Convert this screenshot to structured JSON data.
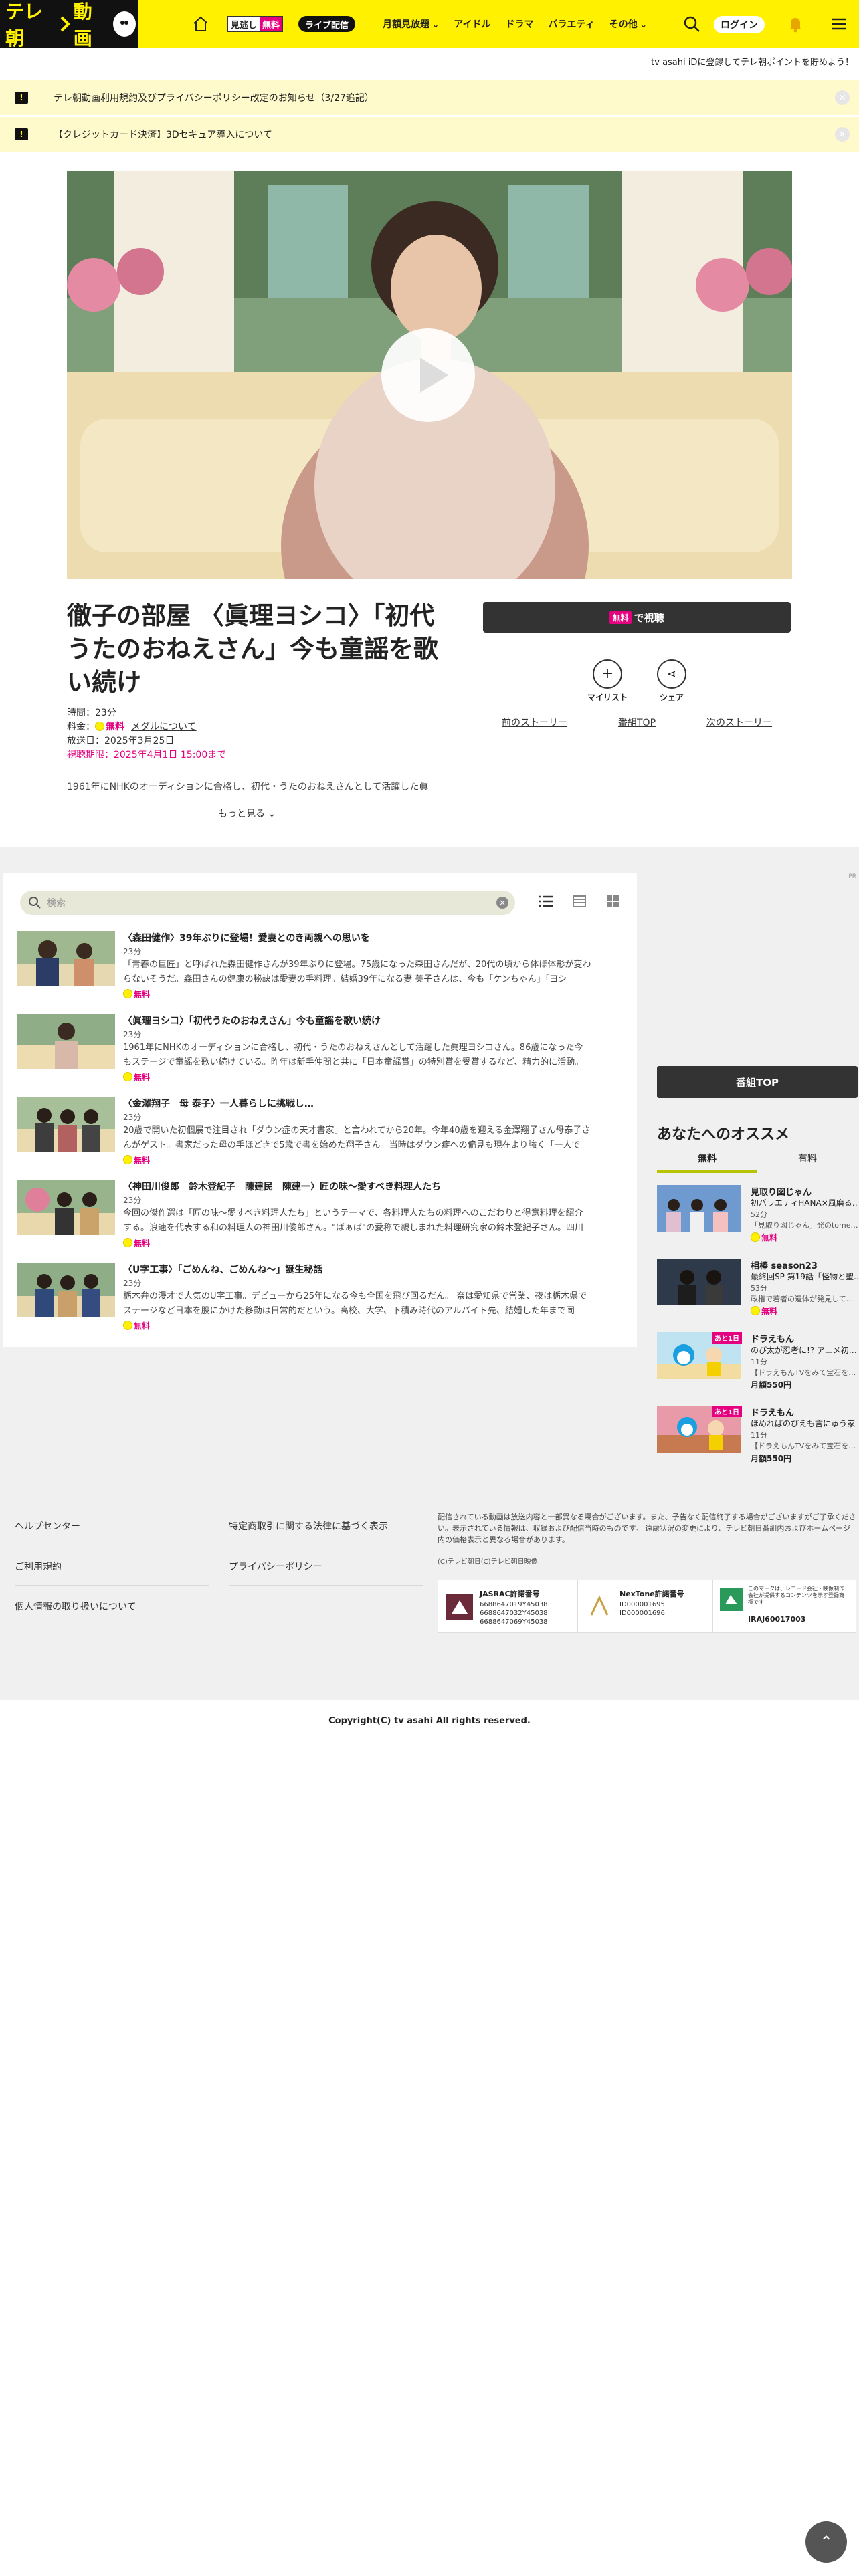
{
  "header": {
    "logo_text": "テレ朝",
    "logo_text2": "動画",
    "free_chip": [
      "見逃し",
      "無料"
    ],
    "live_chip": "ライブ配信",
    "nav": [
      "月額見放題",
      "アイドル",
      "ドラマ",
      "バラエティ",
      "その他"
    ],
    "login": "ログイン"
  },
  "promo": "tv asahi iDに登録してテレ朝ポイントを貯めよう！",
  "notices": [
    "テレ朝動画利用規約及びプライバシーポリシー改定のお知らせ（3/27追記）",
    "【クレジットカード決済】3Dセキュア導入について"
  ],
  "episode": {
    "title": "徹子の部屋 〈眞理ヨシコ〉「初代うたのおねえさん」今も童謡を歌い続け",
    "duration": "時間：23分",
    "fee_label": "料金：",
    "fee": "無料",
    "medal_link": "メダルについて",
    "aired": "放送日：2025年3月25日",
    "deadline": "視聴期限：2025年4月1日 15:00まで",
    "desc": "1961年にNHKのオーディションに合格し、初代・うたのおねえさんとして活躍した眞理ヨ",
    "more": "もっと見る",
    "watch_free": "無料",
    "watch_label": "で視聴",
    "mylist": "マイリスト",
    "share": "シェア",
    "prev": "前のストーリー",
    "program_top": "番組TOP",
    "next": "次のストーリー"
  },
  "pr": "PR",
  "search_placeholder": "検索",
  "episodes": [
    {
      "title": "〈森田健作〉39年ぶりに登場！愛妻とのき両親への思いを",
      "dur": "23分",
      "summary": "「青春の巨匠」と呼ばれた森田健作さんが39年ぶりに登場。75歳になった森田さんだが、20代の頃から体ほ体形が変わらないそうだ。森田さんの健康の秘訣は愛妻の手料理。結婚39年になる妻 美子さんは、今も「ケンちゃん」「ヨシ",
      "free": "無料"
    },
    {
      "title": "〈眞理ヨシコ〉「初代うたのおねえさん」今も童謡を歌い続け",
      "dur": "23分",
      "summary": "1961年にNHKのオーディションに合格し、初代・うたのおねえさんとして活躍した眞理ヨシコさん。86歳になった今もステージで童謡を歌い続けている。昨年は新手仲間と共に「日本童謡賞」の特別賞を受賞するなど、精力的に活動。",
      "free": "無料"
    },
    {
      "title": "〈金澤翔子　母 泰子〉一人暮らしに挑戦し…",
      "dur": "23分",
      "summary": "20歳で開いた初個展で注目され「ダウン症の天才書家」と言われてから20年。今年40歳を迎える金澤翔子さん母泰子さんがゲスト。書家だった母の手ほどきで5歳で書を始めた翔子さん。当時はダウン症への偏見も現在より強く「一人で",
      "free": "無料"
    },
    {
      "title": "〈神田川俊郎　鈴木登紀子　陳建民　陳建一〉匠の味～愛すべき料理人たち",
      "dur": "23分",
      "summary": "今回の傑作選は「匠の味～愛すべき料理人たち」というテーマで、各料理人たちの料理へのこだわりと得意料理を紹介する。浪速を代表する和の料理人の神田川俊郎さん。\"ばぁば\"の愛称で親しまれた料理研究家の鈴木登紀子さん。四川",
      "free": "無料"
    },
    {
      "title": "〈U字工事〉「ごめんね、ごめんね～」誕生秘話",
      "dur": "23分",
      "summary": "栃木弁の漫才で人気のU字工事。デビューから25年になる今も全国を飛び回るだん。 奈は愛知県で営業、夜は栃木県でステージなど日本を股にかけた移動は日常的だという。高校、大学、下積み時代のアルバイト先、結婚した年まで同",
      "free": "無料"
    }
  ],
  "sidebar": {
    "program_top": "番組TOP",
    "rec_title": "あなたへのオススメ",
    "tab_free": "無料",
    "tab_paid": "有料",
    "items": [
      {
        "t1": "見取り図じゃん",
        "t2": "初バラエティHANA×風磨る…",
        "t3": "52分",
        "t4": "「見取り図じゃん」発のtome…",
        "t5": "無料",
        "tag": ""
      },
      {
        "t1": "相棒 season23",
        "t2": "最終回SP 第19話「怪物と聖…",
        "t3": "53分",
        "t4": "政権で若者の遺体が発見して…",
        "t5": "無料",
        "tag": ""
      },
      {
        "t1": "ドラえもん",
        "t2": "のび太が忍者に!? アニメ初…",
        "t3": "11分",
        "t4": "【ドラえもんTVをみて宝石を…",
        "t5": "月額550円",
        "tag": "あと1日"
      },
      {
        "t1": "ドラえもん",
        "t2": "ほめればのびえも言にゅう家",
        "t3": "11分",
        "t4": "【ドラえもんTVをみて宝石を…",
        "t5": "月額550円",
        "tag": "あと1日"
      }
    ]
  },
  "footer": {
    "col1": [
      "ヘルプセンター",
      "ご利用規約",
      "個人情報の取り扱いについて"
    ],
    "col2": [
      "特定商取引に関する法律に基づく表示",
      "プライバシーポリシー"
    ],
    "note": "配信されている動画は放送内容と一部異なる場合がございます。また、予告なく配信終了する場合がございますがご了承ください。表示されている情報は、収録および配信当時のものです。 遠慮状況の変更により、テレビ朝日番組内およびホームページ内の価格表示と異なる場合があります。",
    "small": "(C)テレビ朝日(C)テレビ朝日映像",
    "jasrac_title": "JASRAC許諾番号",
    "jasrac_nums": "6688647019Y45038\n6688647032Y45038\n6688647069Y45038",
    "nextone_title": "NexTone許諾番号",
    "nextone_nums": "ID000001695\nID000001696",
    "riaj_text": "このマークは、レコード会社・映像制作会社が提供するコンテンツを示す登録商標です",
    "riaj_num": "IRAJ60017003",
    "copyright": "Copyright(C) tv asahi All rights reserved."
  },
  "colors": {
    "brand_yellow": "#fff100",
    "accent_pink": "#e4007f",
    "dark": "#333333"
  }
}
